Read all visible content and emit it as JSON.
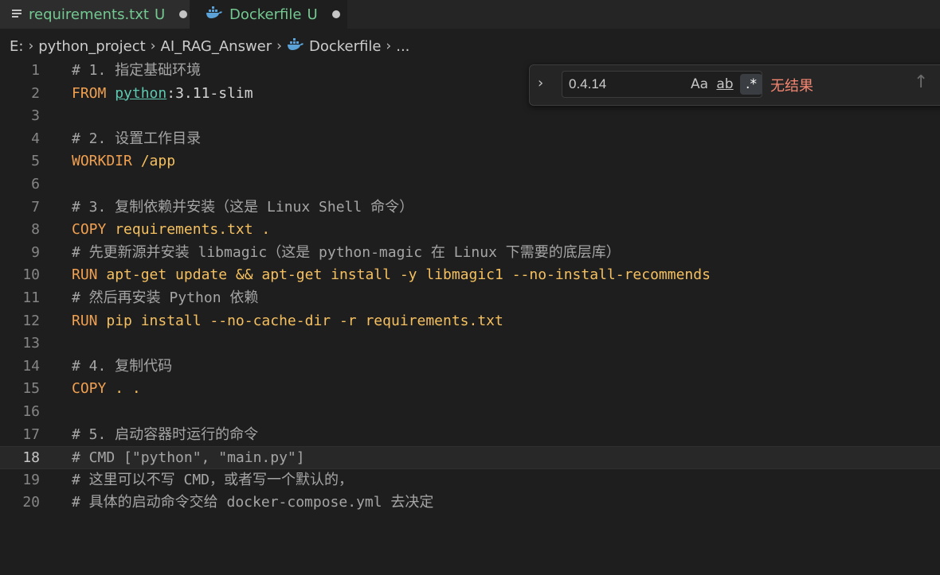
{
  "tabs": [
    {
      "label": "requirements.txt",
      "status": "U"
    },
    {
      "label": "Dockerfile",
      "status": "U"
    }
  ],
  "breadcrumb": [
    "E:",
    "python_project",
    "AI_RAG_Answer",
    "Dockerfile",
    "..."
  ],
  "find": {
    "query": "0.4.14",
    "case_label": "Aa",
    "word_label": "ab",
    "regex_label": ".*",
    "result_text": "无结果"
  },
  "editor": {
    "current_line": 18,
    "lines": [
      {
        "n": "1",
        "text": "# 1. 指定基础环境"
      },
      {
        "n": "2",
        "kw": "FROM",
        "image": "python",
        "rest": ":3.11-slim"
      },
      {
        "n": "3",
        "text": ""
      },
      {
        "n": "4",
        "text": "# 2. 设置工作目录"
      },
      {
        "n": "5",
        "kw": "WORKDIR",
        "args": "/app"
      },
      {
        "n": "6",
        "text": ""
      },
      {
        "n": "7",
        "text": "# 3. 复制依赖并安装（这是 Linux Shell 命令）"
      },
      {
        "n": "8",
        "kw": "COPY",
        "args": "requirements.txt ."
      },
      {
        "n": "9",
        "text": "# 先更新源并安装 libmagic（这是 python-magic 在 Linux 下需要的底层库）"
      },
      {
        "n": "10",
        "kw": "RUN",
        "args": "apt-get update && apt-get install -y libmagic1 --no-install-recommends"
      },
      {
        "n": "11",
        "text": "# 然后再安装 Python 依赖"
      },
      {
        "n": "12",
        "kw": "RUN",
        "args": "pip install --no-cache-dir -r requirements.txt"
      },
      {
        "n": "13",
        "text": ""
      },
      {
        "n": "14",
        "text": "# 4. 复制代码"
      },
      {
        "n": "15",
        "kw": "COPY",
        "args": ". ."
      },
      {
        "n": "16",
        "text": ""
      },
      {
        "n": "17",
        "text": "# 5. 启动容器时运行的命令"
      },
      {
        "n": "18",
        "text": "# CMD [\"python\", \"main.py\"]"
      },
      {
        "n": "19",
        "text": "# 这里可以不写 CMD，或者写一个默认的，"
      },
      {
        "n": "20",
        "text": "# 具体的启动命令交给 docker-compose.yml 去决定"
      }
    ]
  }
}
